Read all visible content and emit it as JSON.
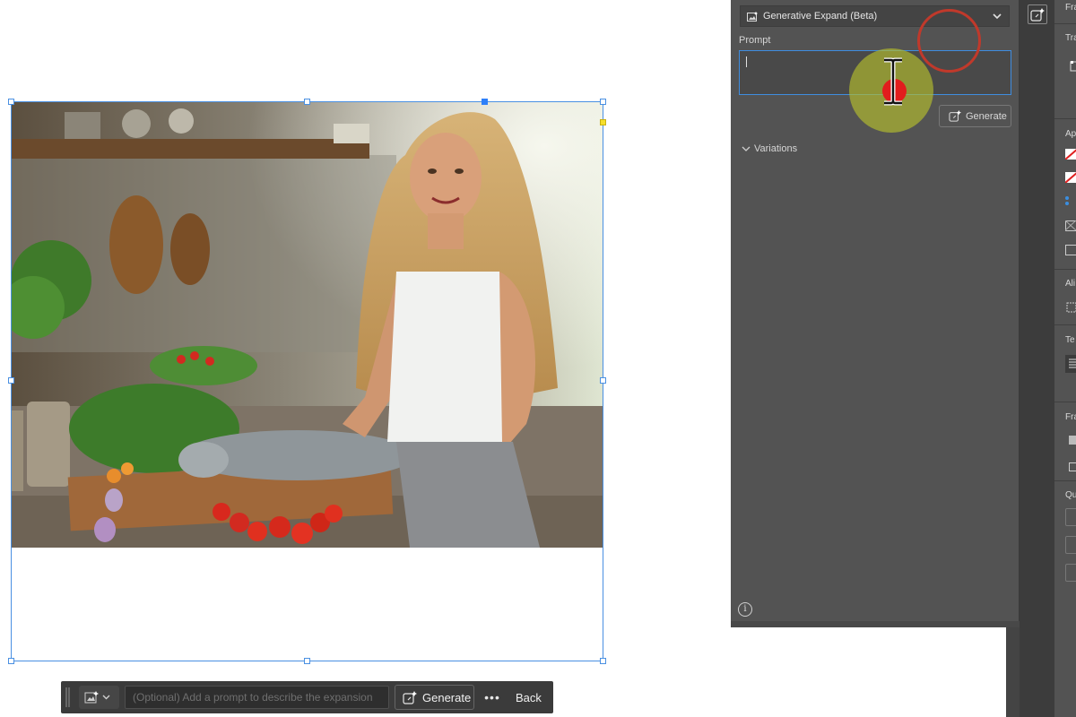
{
  "context_bar": {
    "prompt_placeholder": "(Optional) Add a prompt to describe the expansion",
    "generate_label": "Generate",
    "more_label": "•••",
    "back_label": "Back"
  },
  "generative_panel": {
    "mode_selected": "Generative Expand (Beta)",
    "prompt_label": "Prompt",
    "prompt_value": "",
    "generate_label": "Generate",
    "variations_label": "Variations",
    "info_label": "i"
  },
  "properties_panel": {
    "sections": [
      "Fra",
      "Tra",
      "Ap",
      "Ali",
      "Te",
      "Fra",
      "Qu"
    ]
  },
  "icons": {
    "mode": "generative-expand-icon",
    "chevron": "chevron-down-icon",
    "generate": "sparkle-generate-icon",
    "info": "info-icon"
  },
  "colors": {
    "selection": "#4a90e2",
    "panel_bg": "#535353",
    "dark_bg": "#3b3b3b",
    "cursor_halo": "#b5bf2c",
    "cursor_ring": "#c0392b"
  }
}
